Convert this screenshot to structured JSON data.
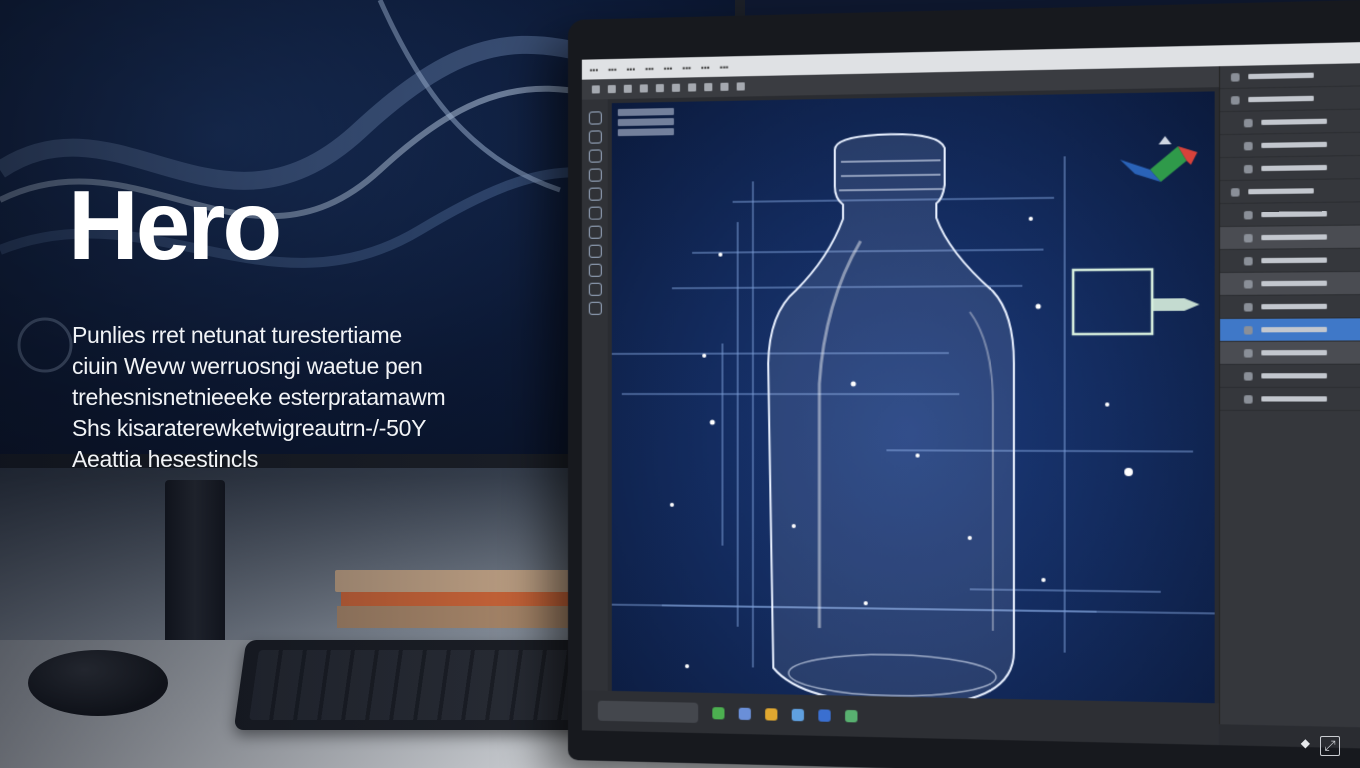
{
  "hero": {
    "title": "Hero",
    "lines": [
      "Punlies rret netunat turestertiame",
      "ciuin Wevw  werruosngi  waetue pen",
      "trehesnisnetnieeeke esterpratamawm",
      "Shs kisaraterewketwigreautrn-/-50Y",
      "Aeattia hesestincls"
    ]
  },
  "colors": {
    "accent": "#3f78c8",
    "canvas_bg": "#132b5e",
    "wireframe": "#9fc4ff"
  },
  "icons": [
    "tool-icon",
    "layer-icon",
    "expand-icon",
    "diamond-icon"
  ]
}
